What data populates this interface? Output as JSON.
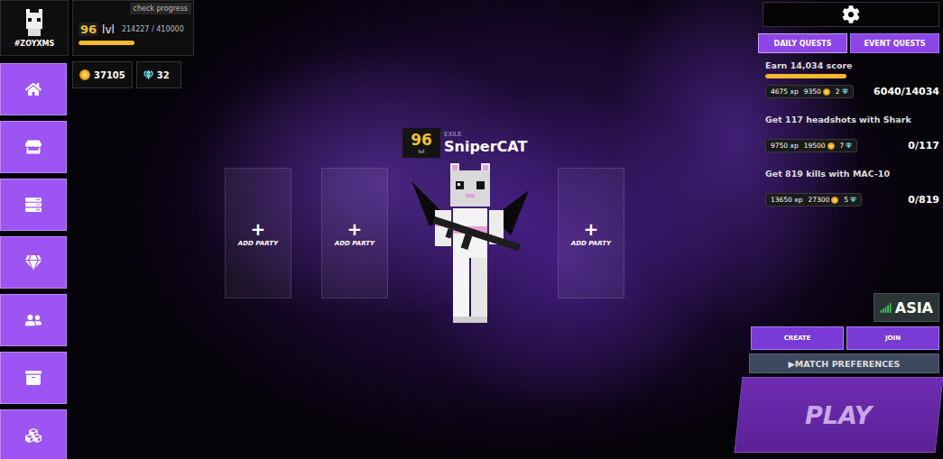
{
  "player": {
    "tag": "#ZOYXMS",
    "level": "96",
    "level_label": "lvl",
    "xp": "214227 / 410000",
    "xp_level": 0.52,
    "progress_link": "check progress"
  },
  "currency": {
    "coins": "37105",
    "gems": "32"
  },
  "party": {
    "slots": [
      {
        "icon": "+",
        "label": "ADD PARTY"
      },
      {
        "icon": "+",
        "label": "ADD PARTY"
      },
      {
        "icon": "+",
        "label": "ADD PARTY"
      }
    ]
  },
  "character": {
    "level": "96",
    "level_label": "lvl",
    "title": "EXILE",
    "name": "SniperCAT"
  },
  "quests": {
    "tabs": [
      {
        "label": "DAILY QUESTS",
        "selected": true
      },
      {
        "label": "EVENT QUESTS",
        "selected": false
      }
    ],
    "items": [
      {
        "title": "Earn 14,034 score",
        "xp": "4675 xp",
        "coins": "9350",
        "gems": "2",
        "progress": "6040/14034",
        "level": 0.43
      },
      {
        "title": "Get 117 headshots with Shark",
        "xp": "9750 xp",
        "coins": "19500",
        "gems": "7",
        "progress": "0/117",
        "level": 0
      },
      {
        "title": "Get 819 kills with MAC-10",
        "xp": "13650 xp",
        "coins": "27300",
        "gems": "5",
        "progress": "0/819",
        "level": 0
      }
    ]
  },
  "region": "ASIA",
  "buttons": {
    "create": "CREATE",
    "join": "JOIN",
    "preferences": "▶MATCH PREFERENCES",
    "play": "PLAY"
  }
}
